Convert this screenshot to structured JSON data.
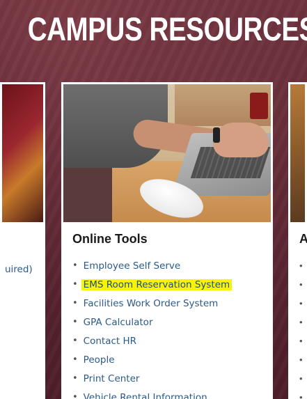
{
  "page": {
    "title": "CAMPUS RESOURCES"
  },
  "left_card": {
    "partial_text": "uired)"
  },
  "main_card": {
    "heading": "Online Tools",
    "links": [
      {
        "label": "Employee Self Serve",
        "highlighted": false
      },
      {
        "label": "EMS Room Reservation System",
        "highlighted": true
      },
      {
        "label": "Facilities Work Order System",
        "highlighted": false
      },
      {
        "label": "GPA Calculator",
        "highlighted": false
      },
      {
        "label": "Contact HR",
        "highlighted": false
      },
      {
        "label": "People",
        "highlighted": false
      },
      {
        "label": "Print Center",
        "highlighted": false
      },
      {
        "label": "Vehicle Rental Information",
        "highlighted": false
      }
    ],
    "bullet": "•"
  },
  "right_card": {
    "heading": "A",
    "bullet": "•"
  },
  "colors": {
    "background": "#5a2630",
    "link": "#2a5a8a",
    "highlight": "#fbf300",
    "heading": "#1a1a1a"
  }
}
